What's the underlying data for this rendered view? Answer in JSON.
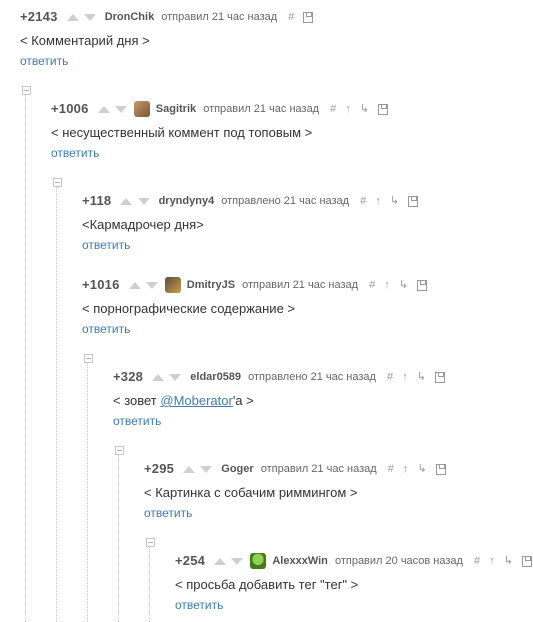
{
  "comments": [
    {
      "rating": "+2143",
      "user": "DronChik",
      "meta": "отправил 21 час назад",
      "text": "< Комментарий дня >",
      "reply": "ответить"
    },
    {
      "rating": "+1006",
      "user": "Sagitrik",
      "meta": "отправил 21 час назад",
      "text": "< несущественный коммент под топовым >",
      "reply": "ответить"
    },
    {
      "rating": "+118",
      "user": "dryndyny4",
      "meta": "отправлено 21 час назад",
      "text": "<Кармадрочер дня>",
      "reply": "ответить"
    },
    {
      "rating": "+1016",
      "user": "DmitryJS",
      "meta": "отправил 21 час назад",
      "text": "< порнографические содержание >",
      "reply": "ответить"
    },
    {
      "rating": "+328",
      "user": "eldar0589",
      "meta": "отправлено 21 час назад",
      "text_before": "< зовет ",
      "mention": "@Moberator",
      "text_after": "'а >",
      "reply": "ответить"
    },
    {
      "rating": "+295",
      "user": "Goger",
      "meta": "отправил 21 час назад",
      "text": "< Картинка с собачим риммингом >",
      "reply": "ответить"
    },
    {
      "rating": "+254",
      "user": "AlexxxWin",
      "meta": "отправил 20 часов назад",
      "text": "< просьба добавить тег \"тег\" >",
      "reply": "ответить"
    }
  ],
  "icons": {
    "link": "#",
    "parent": "↑",
    "thread": "↳",
    "save": "floppy-icon"
  }
}
